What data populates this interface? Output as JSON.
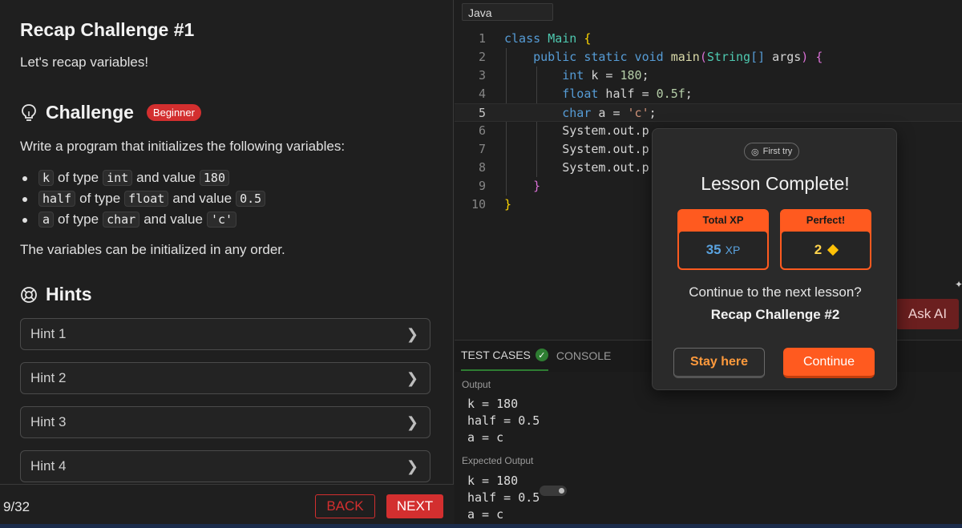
{
  "lesson": {
    "title": "Recap Challenge #1",
    "intro": "Let's recap variables!",
    "challenge_heading": "Challenge",
    "difficulty_badge": "Beginner",
    "description": "Write a program that initializes the following variables:",
    "variables": [
      {
        "name": "k",
        "of_type": "of type",
        "type": "int",
        "and_value": "and value",
        "value": "180"
      },
      {
        "name": "half",
        "of_type": "of type",
        "type": "float",
        "and_value": "and value",
        "value": "0.5"
      },
      {
        "name": "a",
        "of_type": "of type",
        "type": "char",
        "and_value": "and value",
        "value": "'c'"
      }
    ],
    "order_note": "The variables can be initialized in any order.",
    "hints_heading": "Hints",
    "hints": [
      "Hint 1",
      "Hint 2",
      "Hint 3",
      "Hint 4"
    ],
    "progress": "9/32",
    "back_label": "BACK",
    "next_label": "NEXT"
  },
  "editor": {
    "language": "Java",
    "line_numbers": [
      "1",
      "2",
      "3",
      "4",
      "5",
      "6",
      "7",
      "8",
      "9",
      "10"
    ],
    "active_line": 5,
    "ask_ai_label": "Ask AI"
  },
  "output_panel": {
    "tab_test_cases": "TEST CASES",
    "tab_console": "CONSOLE",
    "output_label": "Output",
    "output_lines": [
      "k = 180",
      "half = 0.5",
      "a = c"
    ],
    "expected_label": "Expected Output",
    "expected_lines": [
      "k = 180",
      "half = 0.5",
      "a = c"
    ]
  },
  "modal": {
    "first_try": "First try",
    "title": "Lesson Complete!",
    "total_xp_label": "Total XP",
    "total_xp_value": "35",
    "xp_unit": "XP",
    "perfect_label": "Perfect!",
    "perfect_value": "2",
    "continue_question": "Continue to the next lesson?",
    "next_lesson": "Recap Challenge #2",
    "stay_label": "Stay here",
    "continue_label": "Continue"
  },
  "colors": {
    "accent_red": "#d32f2f",
    "accent_orange": "#ff5a1f",
    "success_green": "#2e7d32",
    "xp_blue": "#5aa3e0"
  }
}
